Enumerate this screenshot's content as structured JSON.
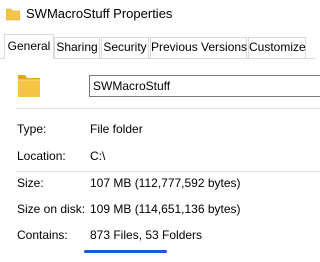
{
  "window": {
    "title": "SWMacroStuff Properties",
    "title_icon": "folder-icon"
  },
  "tabs": [
    {
      "label": "General",
      "selected": true
    },
    {
      "label": "Sharing",
      "selected": false
    },
    {
      "label": "Security",
      "selected": false
    },
    {
      "label": "Previous Versions",
      "selected": false
    },
    {
      "label": "Customize",
      "selected": false
    }
  ],
  "general": {
    "folder_icon": "folder-icon",
    "name_value": "SWMacroStuff",
    "rows": [
      {
        "label": "Type:",
        "value": "File folder"
      },
      {
        "label": "Location:",
        "value": "C:\\"
      },
      {
        "label": "Size:",
        "value": "107 MB (112,777,592 bytes)"
      },
      {
        "label": "Size on disk:",
        "value": "109 MB (114,651,136 bytes)"
      },
      {
        "label": "Contains:",
        "value": "873 Files, 53 Folders"
      }
    ]
  },
  "colors": {
    "folder": "#f6c544",
    "folder_dark": "#e0a825",
    "underline": "#1b57d8",
    "tab_border": "#d9d9d9"
  }
}
